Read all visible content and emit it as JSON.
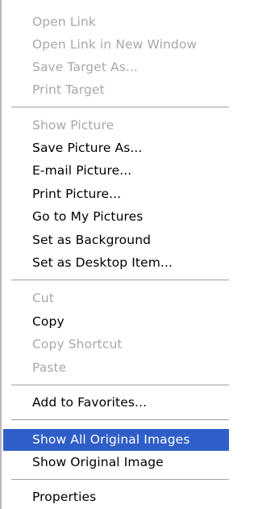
{
  "context_menu": {
    "groups": [
      {
        "items": [
          {
            "label": "Open Link",
            "enabled": false
          },
          {
            "label": "Open Link in New Window",
            "enabled": false
          },
          {
            "label": "Save Target As...",
            "enabled": false
          },
          {
            "label": "Print Target",
            "enabled": false
          }
        ]
      },
      {
        "items": [
          {
            "label": "Show Picture",
            "enabled": false
          },
          {
            "label": "Save Picture As...",
            "enabled": true
          },
          {
            "label": "E-mail Picture...",
            "enabled": true
          },
          {
            "label": "Print Picture...",
            "enabled": true
          },
          {
            "label": "Go to My Pictures",
            "enabled": true
          },
          {
            "label": "Set as Background",
            "enabled": true
          },
          {
            "label": "Set as Desktop Item...",
            "enabled": true
          }
        ]
      },
      {
        "items": [
          {
            "label": "Cut",
            "enabled": false
          },
          {
            "label": "Copy",
            "enabled": true
          },
          {
            "label": "Copy Shortcut",
            "enabled": false
          },
          {
            "label": "Paste",
            "enabled": false
          }
        ]
      },
      {
        "items": [
          {
            "label": "Add to Favorites...",
            "enabled": true
          }
        ]
      },
      {
        "items": [
          {
            "label": "Show All Original Images",
            "enabled": true,
            "highlighted": true
          },
          {
            "label": "Show Original Image",
            "enabled": true
          }
        ]
      },
      {
        "items": [
          {
            "label": "Properties",
            "enabled": true
          }
        ]
      }
    ]
  },
  "colors": {
    "highlight": "#2f5ec8",
    "disabled_text": "#a8a8a8",
    "separator": "#a0a0a0"
  }
}
